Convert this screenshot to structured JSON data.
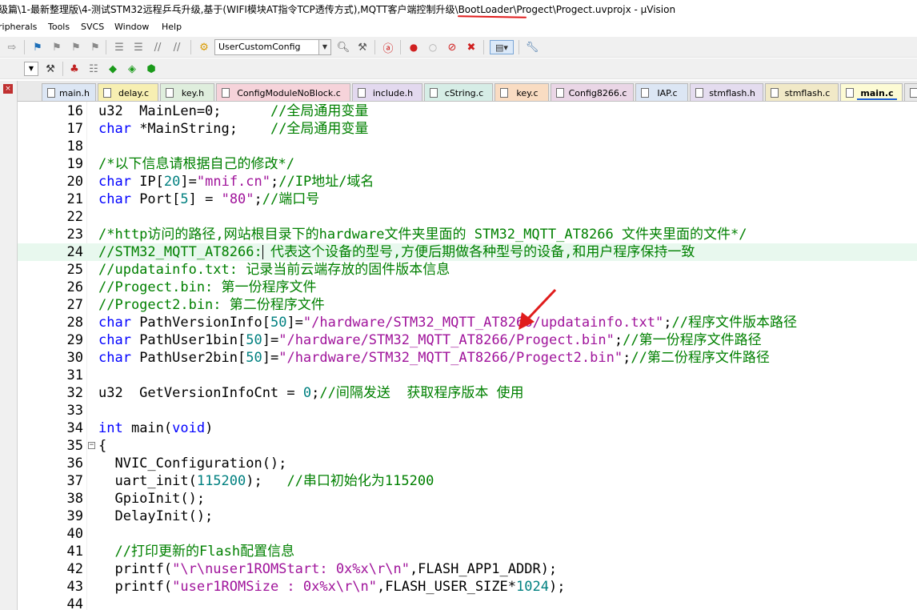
{
  "window": {
    "title_start": "级篇\\1-最新整理版\\4-测试STM32远程乒乓升级,基于(WIFI模块AT指令TCP透传方式),MQTT客户端控制升级\\",
    "title_highlight": "BootLoader",
    "title_end": "\\Progect\\Progect.uvprojx - µVision"
  },
  "menu": [
    "ripherals",
    "Tools",
    "SVCS",
    "Window",
    "Help"
  ],
  "toolbar": {
    "target_combo": "UserCustomConfig"
  },
  "tabs": [
    {
      "label": "main.h",
      "color": "#dce6f4"
    },
    {
      "label": "delay.c",
      "color": "#f7efb2"
    },
    {
      "label": "key.h",
      "color": "#dfeedd"
    },
    {
      "label": "ConfigModuleNoBlock.c",
      "color": "#f6d3da"
    },
    {
      "label": "include.h",
      "color": "#e3d9ef"
    },
    {
      "label": "cString.c",
      "color": "#d6ede6"
    },
    {
      "label": "key.c",
      "color": "#f9dcc2"
    },
    {
      "label": "Config8266.c",
      "color": "#ead6e6"
    },
    {
      "label": "IAP.c",
      "color": "#dce6f4"
    },
    {
      "label": "stmflash.h",
      "color": "#e4dcef"
    },
    {
      "label": "stmflash.c",
      "color": "#f1e9c7"
    },
    {
      "label": "main.c",
      "color": "#fdfbd4",
      "active": true
    }
  ],
  "code": {
    "l16": {
      "num": "16",
      "t1": "u32  MainLen=0;      ",
      "c": "//全局通用变量"
    },
    "l17": {
      "num": "17",
      "k": "char",
      "t1": " *MainString;    ",
      "c": "//全局通用变量"
    },
    "l18": {
      "num": "18"
    },
    "l19": {
      "num": "19",
      "c": "/*以下信息请根据自己的修改*/"
    },
    "l20": {
      "num": "20",
      "k": "char",
      "t1": " IP[",
      "n1": "20",
      "t2": "]=",
      "s": "\"mnif.cn\"",
      "t3": ";",
      "c": "//IP地址/域名"
    },
    "l21": {
      "num": "21",
      "k": "char",
      "t1": " Port[",
      "n1": "5",
      "t2": "] = ",
      "s": "\"80\"",
      "t3": ";",
      "c": "//端口号"
    },
    "l22": {
      "num": "22"
    },
    "l23": {
      "num": "23",
      "c": "/*http访问的路径,网站根目录下的hardware文件夹里面的 STM32_MQTT_AT8266 文件夹里面的文件*/"
    },
    "l24": {
      "num": "24",
      "c1": "//STM32_MQTT_AT8266",
      "c2": ": 代表这个设备的型号,方便后期做各种型号的设备,和用户程序保持一致"
    },
    "l25": {
      "num": "25",
      "c": "//updatainfo.txt: 记录当前云端存放的固件版本信息"
    },
    "l26": {
      "num": "26",
      "c": "//Progect.bin: 第一份程序文件"
    },
    "l27": {
      "num": "27",
      "c": "//Progect2.bin: 第二份程序文件"
    },
    "l28": {
      "num": "28",
      "k": "char",
      "t1": " PathVersionInfo[",
      "n1": "50",
      "t2": "]=",
      "s": "\"/hardware/STM32_MQTT_AT8266/updatainfo.txt\"",
      "t3": ";",
      "c": "//程序文件版本路径"
    },
    "l29": {
      "num": "29",
      "k": "char",
      "t1": " PathUser1bin[",
      "n1": "50",
      "t2": "]=",
      "s": "\"/hardware/STM32_MQTT_AT8266/Progect.bin\"",
      "t3": ";",
      "c": "//第一份程序文件路径"
    },
    "l30": {
      "num": "30",
      "k": "char",
      "t1": " PathUser2bin[",
      "n1": "50",
      "t2": "]=",
      "s": "\"/hardware/STM32_MQTT_AT8266/Progect2.bin\"",
      "t3": ";",
      "c": "//第二份程序文件路径"
    },
    "l31": {
      "num": "31"
    },
    "l32": {
      "num": "32",
      "t1": "u32  GetVersionInfoCnt = ",
      "n1": "0",
      "t2": ";",
      "c": "//间隔发送  获取程序版本 使用"
    },
    "l33": {
      "num": "33"
    },
    "l34": {
      "num": "34",
      "k": "int",
      "t1": " main(",
      "k2": "void",
      "t2": ")"
    },
    "l35": {
      "num": "35",
      "t1": "{"
    },
    "l36": {
      "num": "36",
      "t1": "  NVIC_Configuration();"
    },
    "l37": {
      "num": "37",
      "t1": "  uart_init(",
      "n1": "115200",
      "t2": ");   ",
      "c": "//串口初始化为115200"
    },
    "l38": {
      "num": "38",
      "t1": "  GpioInit();"
    },
    "l39": {
      "num": "39",
      "t1": "  DelayInit();"
    },
    "l40": {
      "num": "40"
    },
    "l41": {
      "num": "41",
      "t1": "  ",
      "c": "//打印更新的Flash配置信息"
    },
    "l42": {
      "num": "42",
      "t1": "  printf(",
      "s": "\"\\r\\nuser1ROMStart: 0x%x\\r\\n\"",
      "t2": ",FLASH_APP1_ADDR);"
    },
    "l43": {
      "num": "43",
      "t1": "  printf(",
      "s": "\"user1ROMSize : 0x%x\\r\\n\"",
      "t2": ",FLASH_USER_SIZE*",
      "n1": "1024",
      "t3": ");"
    },
    "l44": {
      "num": "44"
    }
  },
  "colors": {
    "keyword": "#0000ff",
    "comment": "#008000",
    "string": "#a0149b",
    "number": "#008080",
    "annotation": "#e01c1c",
    "current_line": "#e8f8ee"
  },
  "annotation": {
    "icon": "red-arrow-icon"
  }
}
